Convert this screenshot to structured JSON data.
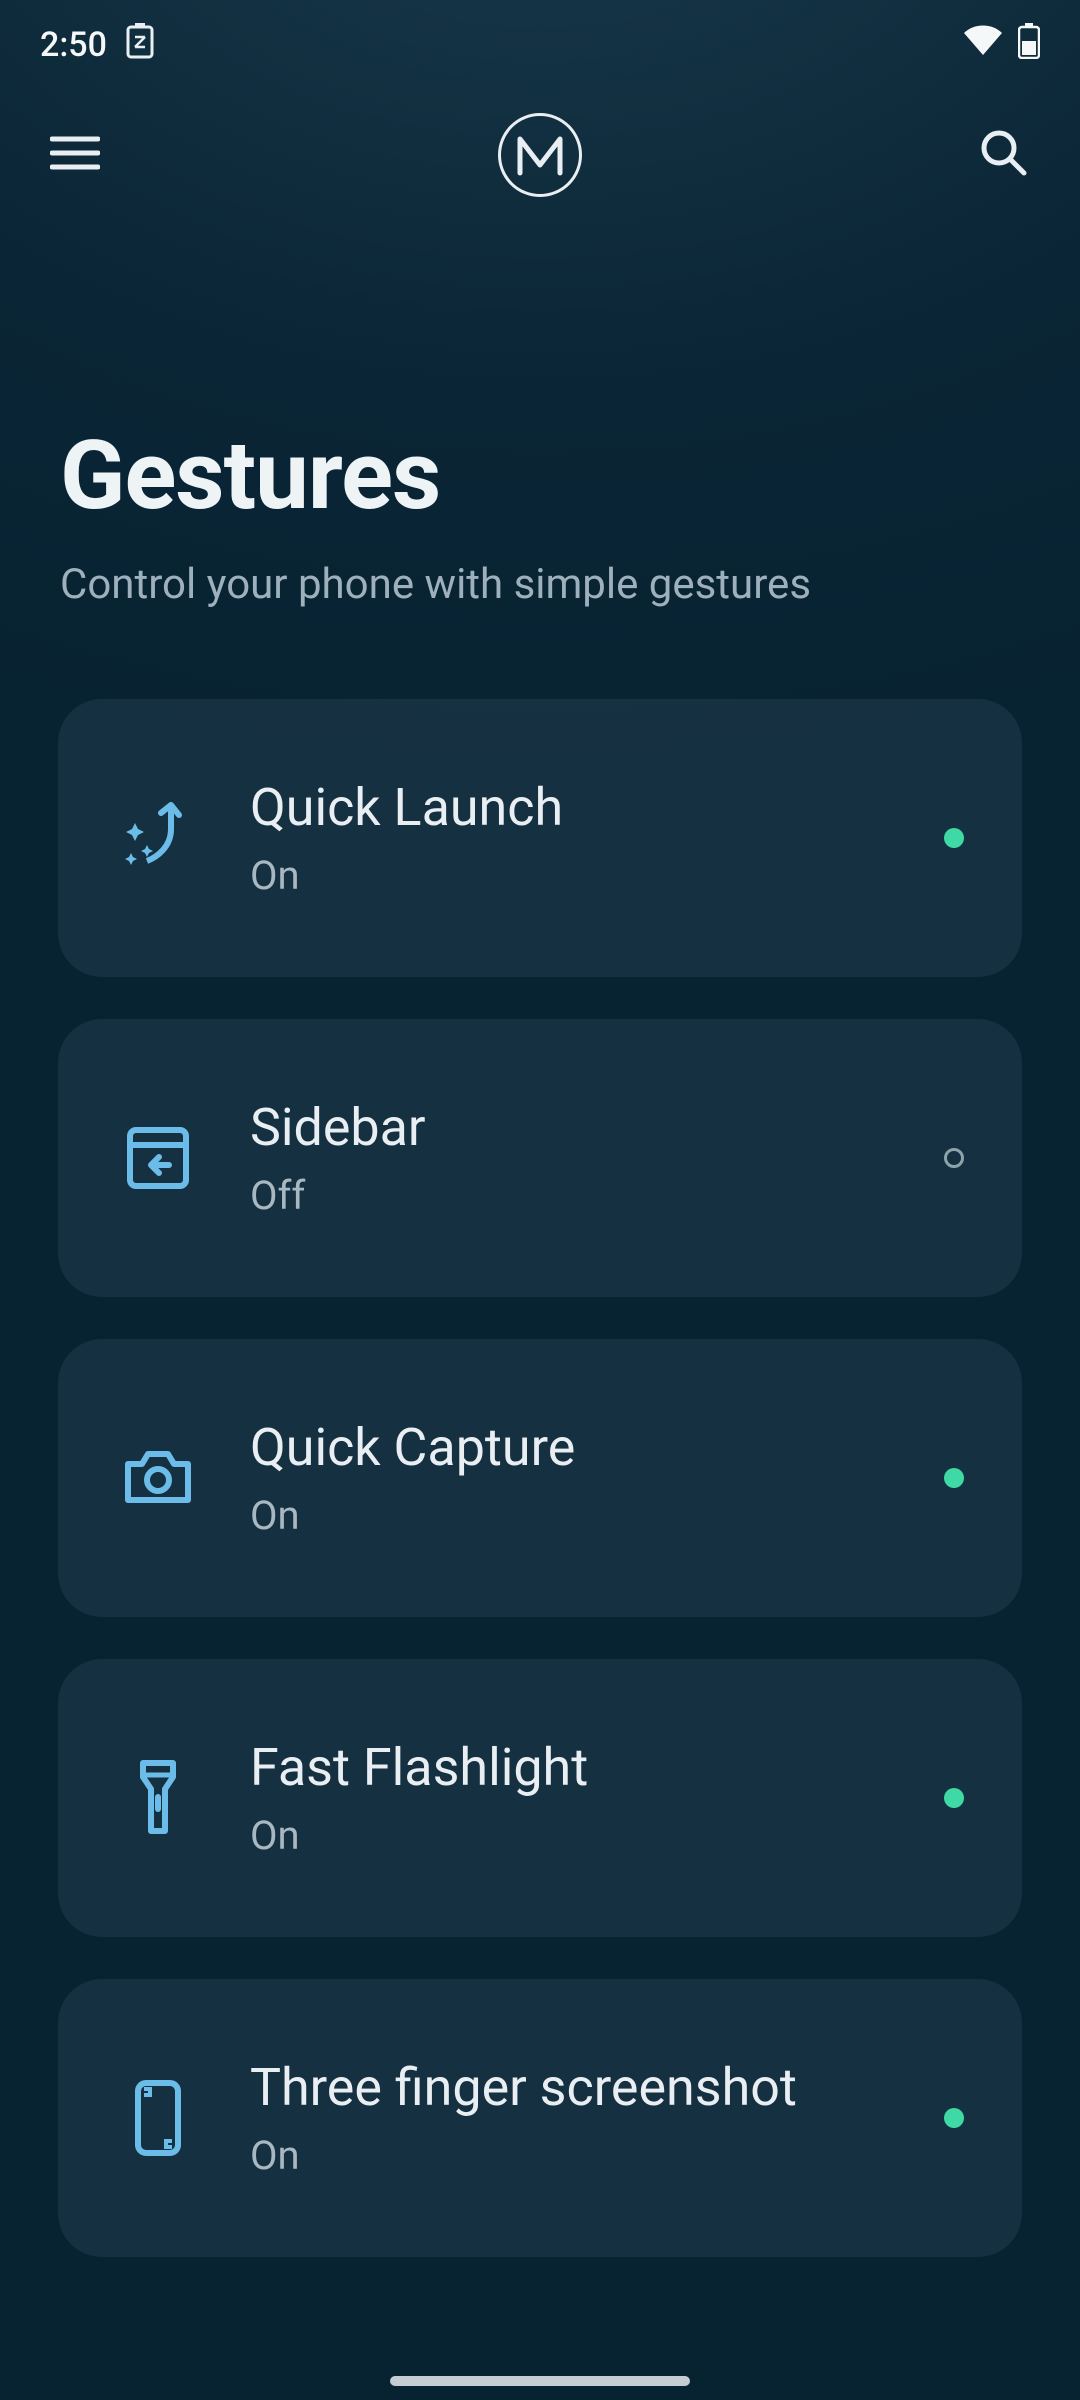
{
  "status": {
    "time": "2:50"
  },
  "page": {
    "title": "Gestures",
    "subtitle": "Control your phone with simple gestures"
  },
  "cards": [
    {
      "title": "Quick Launch",
      "status": "On"
    },
    {
      "title": "Sidebar",
      "status": "Off"
    },
    {
      "title": "Quick Capture",
      "status": "On"
    },
    {
      "title": "Fast Flashlight",
      "status": "On"
    },
    {
      "title": "Three finger screenshot",
      "status": "On"
    }
  ]
}
